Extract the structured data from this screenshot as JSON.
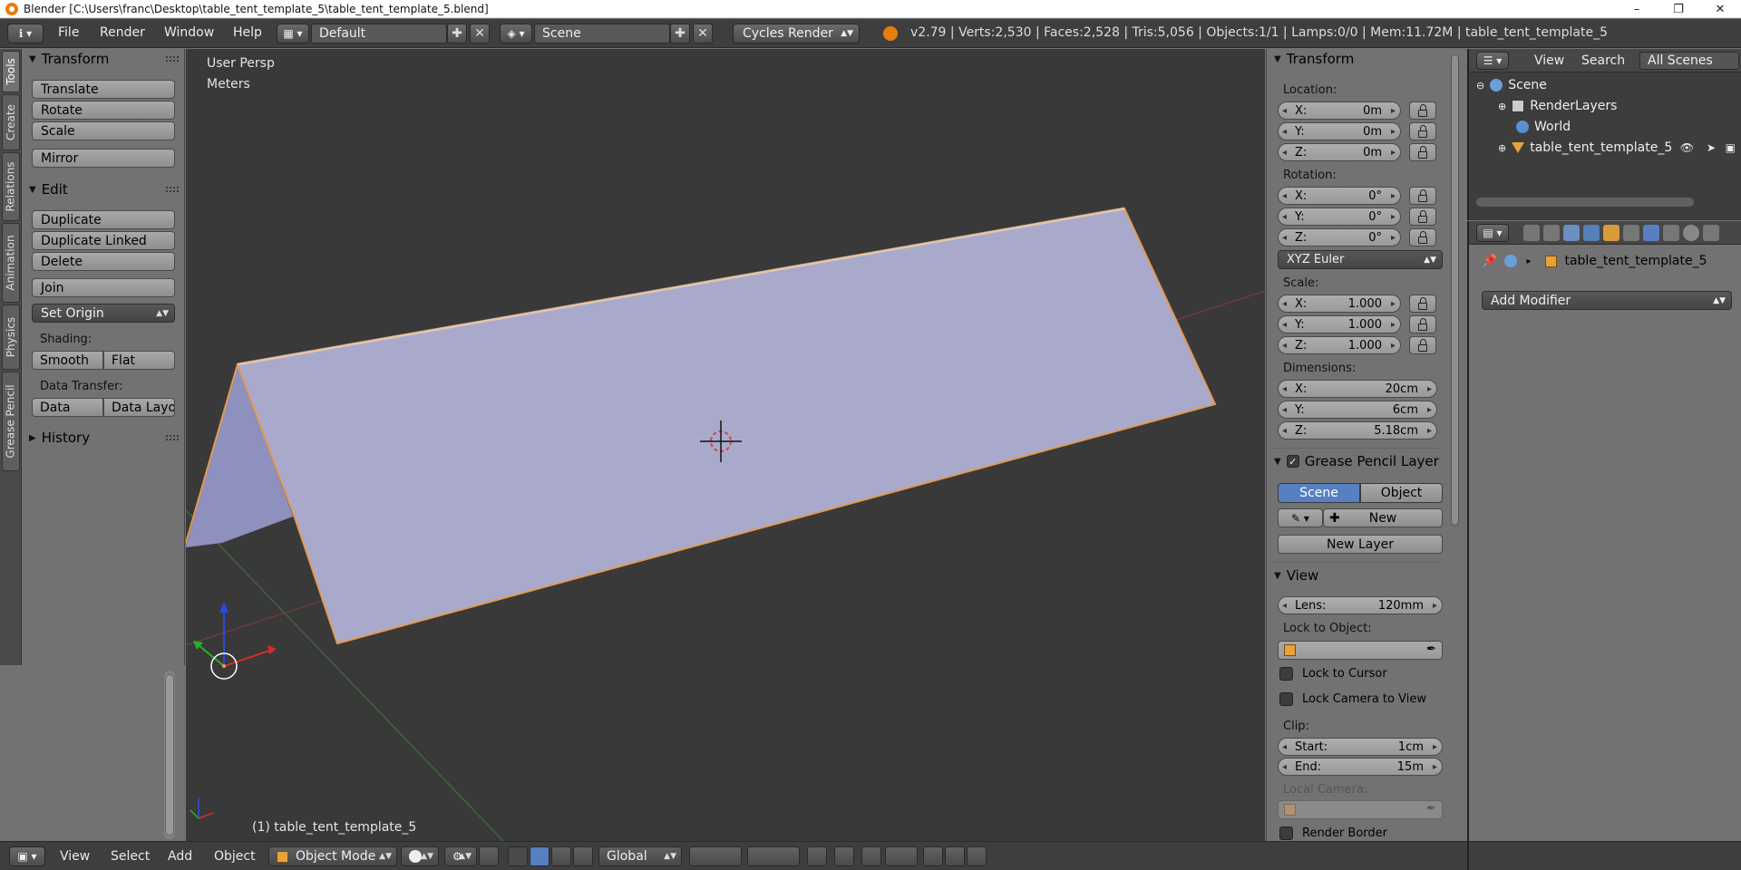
{
  "window": {
    "title": "Blender [C:\\Users\\franc\\Desktop\\table_tent_template_5\\table_tent_template_5.blend]",
    "controls": [
      "–",
      "❐",
      "✕"
    ]
  },
  "info_header": {
    "menus": [
      "File",
      "Render",
      "Window",
      "Help"
    ],
    "screen_layout": "Default",
    "scene": "Scene",
    "render_engine": "Cycles Render",
    "stats": "v2.79 | Verts:2,530 | Faces:2,528 | Tris:5,056 | Objects:1/1 | Lamps:0/0 | Mem:11.72M | table_tent_template_5"
  },
  "left_tabs": [
    "Tools",
    "Create",
    "Relations",
    "Animation",
    "Physics",
    "Grease Pencil"
  ],
  "tool_shelf": {
    "transform": {
      "title": "Transform",
      "buttons": [
        "Translate",
        "Rotate",
        "Scale",
        "Mirror"
      ]
    },
    "edit": {
      "title": "Edit",
      "buttons": [
        "Duplicate",
        "Duplicate Linked",
        "Delete",
        "Join"
      ],
      "set_origin": "Set Origin",
      "shading_label": "Shading:",
      "shading_buttons": [
        "Smooth",
        "Flat"
      ],
      "data_transfer_label": "Data Transfer:",
      "data_transfer_buttons": [
        "Data",
        "Data Layo"
      ]
    },
    "history": {
      "title": "History"
    }
  },
  "viewport": {
    "view_name": "User Persp",
    "units": "Meters",
    "object_label": "(1) table_tent_template_5",
    "object_color": "#a7a8c8",
    "outline_color": "#f0a040"
  },
  "n_panel": {
    "transform_title": "Transform",
    "location_label": "Location:",
    "location": [
      {
        "axis": "X:",
        "value": "0m"
      },
      {
        "axis": "Y:",
        "value": "0m"
      },
      {
        "axis": "Z:",
        "value": "0m"
      }
    ],
    "rotation_label": "Rotation:",
    "rotation": [
      {
        "axis": "X:",
        "value": "0°"
      },
      {
        "axis": "Y:",
        "value": "0°"
      },
      {
        "axis": "Z:",
        "value": "0°"
      }
    ],
    "rotation_mode": "XYZ Euler",
    "scale_label": "Scale:",
    "scale": [
      {
        "axis": "X:",
        "value": "1.000"
      },
      {
        "axis": "Y:",
        "value": "1.000"
      },
      {
        "axis": "Z:",
        "value": "1.000"
      }
    ],
    "dimensions_label": "Dimensions:",
    "dimensions": [
      {
        "axis": "X:",
        "value": "20cm"
      },
      {
        "axis": "Y:",
        "value": "6cm"
      },
      {
        "axis": "Z:",
        "value": "5.18cm"
      }
    ],
    "grease_pencil_title": "Grease Pencil Layer",
    "gp_tabs": [
      "Scene",
      "Object"
    ],
    "gp_new": "New",
    "gp_new_layer": "New Layer",
    "view_title": "View",
    "lens_label": "Lens:",
    "lens_value": "120mm",
    "lock_to_object_label": "Lock to Object:",
    "lock_to_cursor": "Lock to Cursor",
    "lock_camera_to_view": "Lock Camera to View",
    "clip_label": "Clip:",
    "clip_start_label": "Start:",
    "clip_start": "1cm",
    "clip_end_label": "End:",
    "clip_end": "15m",
    "local_camera_label": "Local Camera:",
    "render_border": "Render Border"
  },
  "outliner": {
    "header_menus": [
      "View",
      "Search"
    ],
    "display_mode": "All Scenes",
    "rows": [
      "Scene",
      "RenderLayers",
      "World",
      "table_tent_template_5"
    ]
  },
  "properties": {
    "object_name": "table_tent_template_5",
    "add_modifier": "Add Modifier"
  },
  "bottom_header": {
    "menus": [
      "View",
      "Select",
      "Add",
      "Object"
    ],
    "mode": "Object Mode",
    "orientation": "Global"
  }
}
